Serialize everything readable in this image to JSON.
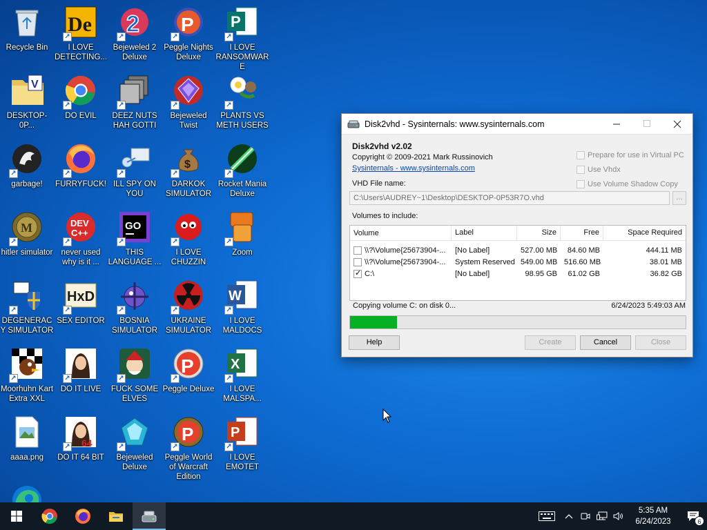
{
  "desktop": {
    "icons": [
      {
        "label": "Recycle Bin",
        "icon": "recycle-bin-icon"
      },
      {
        "label": "I LOVE DETECTING...",
        "icon": "detect-it-easy-icon"
      },
      {
        "label": "Bejeweled 2 Deluxe",
        "icon": "bejeweled-2-icon"
      },
      {
        "label": "Peggle Nights Deluxe",
        "icon": "peggle-nights-icon"
      },
      {
        "label": "I LOVE RANSOMWARE",
        "icon": "publisher-icon"
      },
      {
        "label": "DESKTOP-0P...",
        "icon": "folder-vhd-icon"
      },
      {
        "label": "DO EVIL",
        "icon": "chrome-icon"
      },
      {
        "label": "DEEZ NUTS HAH GOTTI",
        "icon": "windows-stack-icon"
      },
      {
        "label": "Bejeweled Twist",
        "icon": "bejeweled-twist-icon"
      },
      {
        "label": "PLANTS VS METH USERS",
        "icon": "plants-vs-zombies-icon"
      },
      {
        "label": "garbage!",
        "icon": "garbage-icon"
      },
      {
        "label": "FURRYFUCK!",
        "icon": "firefox-icon"
      },
      {
        "label": "ILL SPY ON YOU",
        "icon": "network-monitor-icon"
      },
      {
        "label": "DARKOK SIMULATOR",
        "icon": "money-bag-icon"
      },
      {
        "label": "Rocket Mania Deluxe",
        "icon": "rocket-mania-icon"
      },
      {
        "label": "hitler simulator",
        "icon": "coin-icon"
      },
      {
        "label": "never used why is it ...",
        "icon": "dev-cpp-icon"
      },
      {
        "label": "THIS LANGUAGE ...",
        "icon": "goland-icon"
      },
      {
        "label": "I LOVE CHUZZIN",
        "icon": "chuzzle-icon"
      },
      {
        "label": "Zoom",
        "icon": "zoom-game-icon"
      },
      {
        "label": "DEGENERACY SIMULATOR",
        "icon": "flag-shield-icon"
      },
      {
        "label": "SEX EDITOR",
        "icon": "hxd-icon"
      },
      {
        "label": "BOSNIA SIMULATOR",
        "icon": "mine-icon"
      },
      {
        "label": "UKRAINE SIMULATOR",
        "icon": "radiation-icon"
      },
      {
        "label": "I LOVE MALDOCS",
        "icon": "word-icon"
      },
      {
        "label": "Moorhuhn Kart Extra XXL",
        "icon": "moorhuhn-icon"
      },
      {
        "label": "DO IT LIVE",
        "icon": "portrait-icon"
      },
      {
        "label": "FUCK SOME ELVES",
        "icon": "elves-icon"
      },
      {
        "label": "Peggle Deluxe",
        "icon": "peggle-icon"
      },
      {
        "label": "I LOVE MALSPA...",
        "icon": "excel-icon"
      },
      {
        "label": "aaaa.png",
        "icon": "image-file-icon"
      },
      {
        "label": "DO IT 64 BIT",
        "icon": "portrait-64-icon"
      },
      {
        "label": "Bejeweled Deluxe",
        "icon": "bejeweled-deluxe-icon"
      },
      {
        "label": "Peggle World of Warcraft Edition",
        "icon": "peggle-wow-icon"
      },
      {
        "label": "I LOVE EMOTET",
        "icon": "powerpoint-icon"
      },
      {
        "label": "Microsoft Edge",
        "icon": "edge-icon"
      }
    ]
  },
  "window": {
    "title": "Disk2vhd - Sysinternals: www.sysinternals.com",
    "app_name": "Disk2vhd v2.02",
    "copyright": "Copyright  © 2009-2021 Mark Russinovich",
    "link": "Sysinternals - www.sysinternals.com",
    "options": {
      "prepare_virtual_pc": "Prepare for use in Virtual PC",
      "use_vhdx": "Use Vhdx",
      "use_shadow_copy": "Use Volume Shadow Copy"
    },
    "vhd_label": "VHD File name:",
    "vhd_path": "C:\\Users\\AUDREY~1\\Desktop\\DESKTOP-0P53R7O.vhd",
    "browse_label": "...",
    "volumes_label": "Volumes to include:",
    "columns": [
      "Volume",
      "Label",
      "Size",
      "Free",
      "Space Required"
    ],
    "volumes": [
      {
        "volume": "\\\\?\\Volume{25673904-...",
        "label": "[No Label]",
        "size": "527.00 MB",
        "free": "84.60 MB",
        "required": "444.11 MB",
        "checked": false
      },
      {
        "volume": "\\\\?\\Volume{25673904-...",
        "label": "System Reserved",
        "size": "549.00 MB",
        "free": "516.60 MB",
        "required": "38.01 MB",
        "checked": false
      },
      {
        "volume": "C:\\",
        "label": "[No Label]",
        "size": "98.95 GB",
        "free": "61.02 GB",
        "required": "36.82 GB",
        "checked": true
      }
    ],
    "status": "Copying volume C: on disk 0...",
    "timestamp": "6/24/2023 5:49:03 AM",
    "progress": 0.14,
    "buttons": {
      "help": "Help",
      "create": "Create",
      "cancel": "Cancel",
      "close": "Close"
    }
  },
  "taskbar": {
    "clock_time": "5:35 AM",
    "clock_date": "6/24/2023",
    "notification_count": "6"
  },
  "colors": {
    "progress": "#06b025",
    "taskbar": "#101a25",
    "accent": "#76b9ed"
  }
}
